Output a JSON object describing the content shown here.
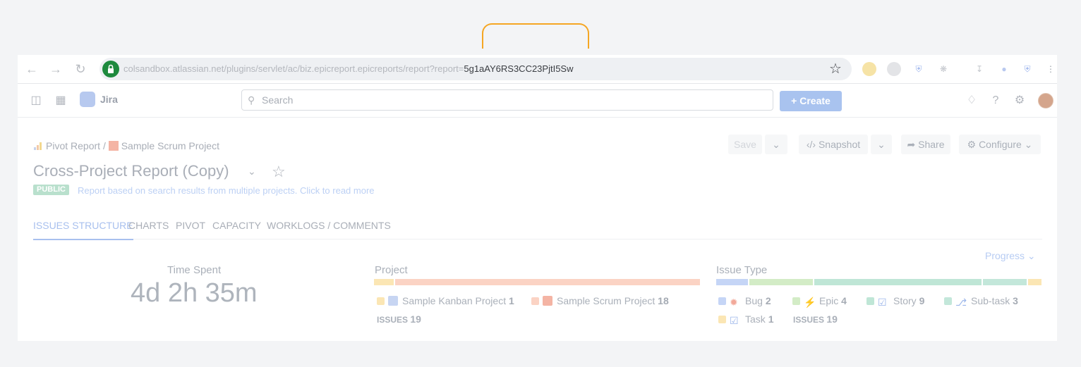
{
  "browser": {
    "url_faded": "colsandbox.atlassian.net/plugins/servlet/ac/biz.epicreport.epicreports/report?report=",
    "url_sharp": "5g1aAY6RS3CC23PjtI5Sw"
  },
  "jira": {
    "product_name": "Jira",
    "search_placeholder": "Search",
    "create_label": "Create"
  },
  "page": {
    "breadcrumb": {
      "root": "Pivot Report",
      "separator": "/",
      "project": "Sample Scrum Project"
    },
    "title": "Cross-Project Report (Copy)",
    "badge": "PUBLIC",
    "description": "Report based on search results from multiple projects. Click to read more",
    "actions": {
      "save": "Save",
      "snapshot": "Snapshot",
      "share": "Share",
      "configure": "Configure"
    }
  },
  "tabs": [
    {
      "label": "ISSUES STRUCTURE",
      "active": true
    },
    {
      "label": "CHARTS",
      "active": false
    },
    {
      "label": "PIVOT",
      "active": false
    },
    {
      "label": "CAPACITY",
      "active": false
    },
    {
      "label": "WORKLOGS / COMMENTS",
      "active": false
    }
  ],
  "progress_label": "Progress",
  "time_spent": {
    "label": "Time Spent",
    "value": "4d 2h 35m"
  },
  "project": {
    "label": "Project",
    "items": [
      {
        "name": "Sample Kanban Project",
        "count": "1",
        "color": "#fbe6b4"
      },
      {
        "name": "Sample Scrum Project",
        "count": "18",
        "color": "#fbd3c4"
      }
    ],
    "total_label": "ISSUES",
    "total_count": "19"
  },
  "issue_type": {
    "label": "Issue Type",
    "items": [
      {
        "name": "Bug",
        "count": "2",
        "color": "#c5d5f6",
        "icon": "bug-icon"
      },
      {
        "name": "Epic",
        "count": "4",
        "color": "#d3ecc6",
        "icon": "epic-icon"
      },
      {
        "name": "Story",
        "count": "9",
        "color": "#bfe6d6",
        "icon": "story-icon"
      },
      {
        "name": "Sub-task",
        "count": "3",
        "color": "#c3e7da",
        "icon": "subtask-icon"
      },
      {
        "name": "Task",
        "count": "1",
        "color": "#fbe6b4",
        "icon": "task-icon"
      }
    ],
    "total_label": "ISSUES",
    "total_count": "19"
  }
}
